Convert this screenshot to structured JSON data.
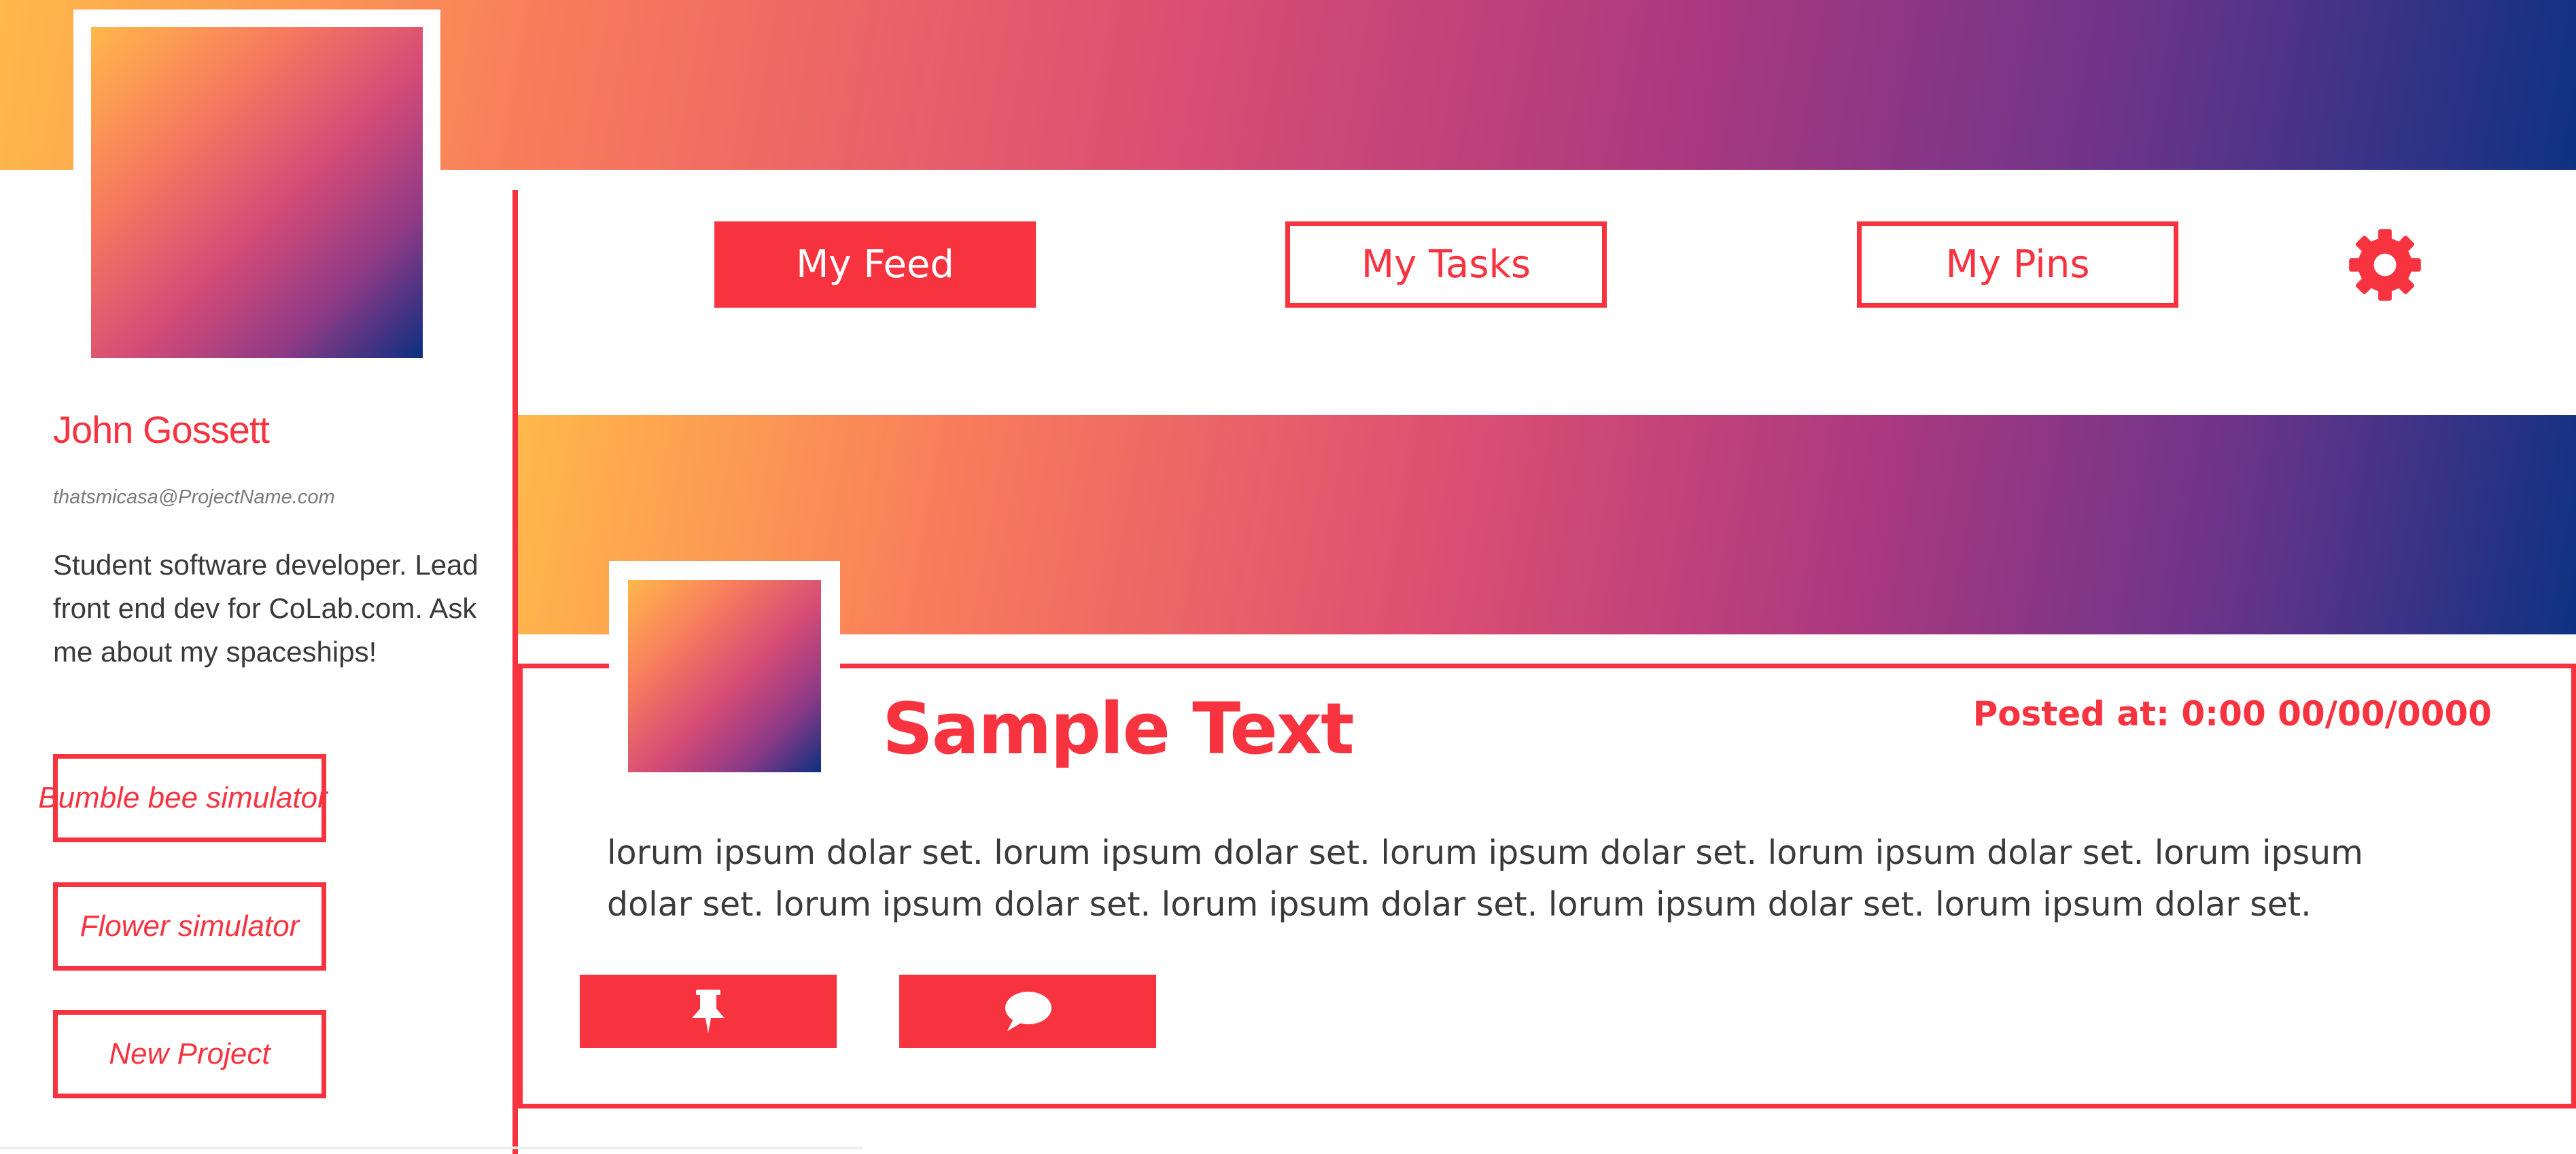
{
  "profile": {
    "name": "John Gossett",
    "email": "thatsmicasa@ProjectName.com",
    "bio": "Student software developer. Lead front end dev for CoLab.com. Ask me about my spaceships!",
    "projects": [
      {
        "label": "Bumble bee simulator"
      },
      {
        "label": "Flower simulator"
      },
      {
        "label": "New Project"
      }
    ]
  },
  "nav": {
    "tabs": [
      {
        "label": "My Feed",
        "active": true
      },
      {
        "label": "My Tasks",
        "active": false
      },
      {
        "label": "My Pins",
        "active": false
      }
    ],
    "settings_icon": "gear-icon"
  },
  "post": {
    "title": "Sample Text",
    "posted_at": "Posted at: 0:00 00/00/0000",
    "body": "lorum ipsum dolar set. lorum ipsum dolar set. lorum ipsum dolar set. lorum ipsum dolar set. lorum ipsum dolar set. lorum ipsum dolar set. lorum ipsum dolar set. lorum ipsum dolar set. lorum ipsum dolar set.",
    "actions": [
      {
        "icon": "pushpin-icon"
      },
      {
        "icon": "comment-icon"
      }
    ]
  },
  "colors": {
    "accent": "#f83340",
    "gradient_start": "#ffb84a",
    "gradient_mid": "#d64c76",
    "gradient_end": "#0e3282"
  }
}
